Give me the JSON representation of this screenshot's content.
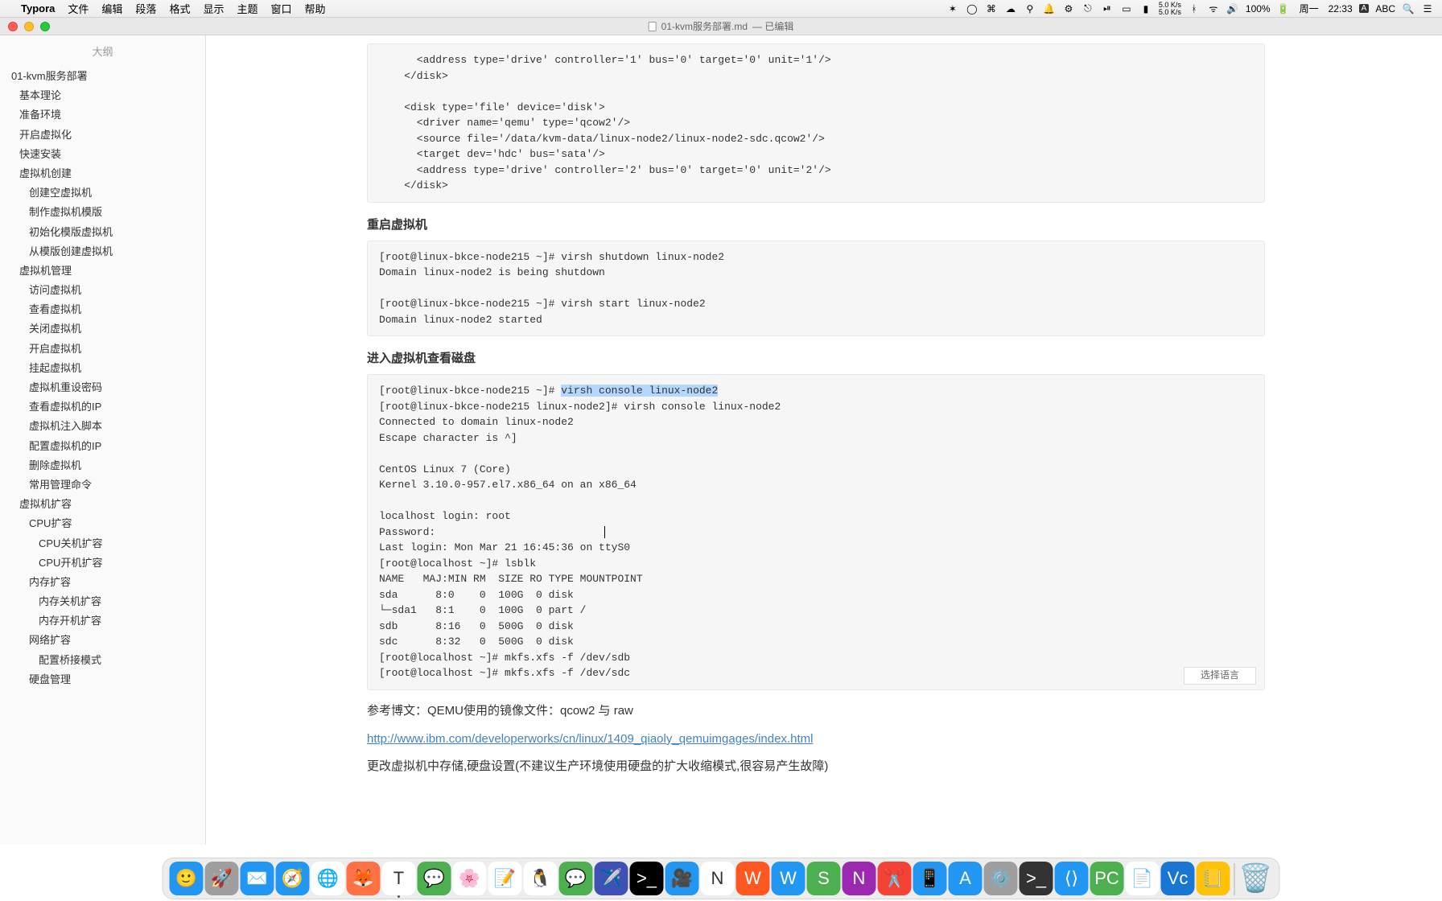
{
  "menubar": {
    "app_name": "Typora",
    "items": [
      "文件",
      "编辑",
      "段落",
      "格式",
      "显示",
      "主题",
      "窗口",
      "帮助"
    ],
    "right": {
      "net_up": "5.0 K/s",
      "net_down": "5.0 K/s",
      "battery": "100%",
      "day": "周一",
      "time": "22:33",
      "input": "ABC"
    }
  },
  "titlebar": {
    "filename": "01-kvm服务部署.md",
    "status": "— 已编辑"
  },
  "sidebar": {
    "title": "大纲",
    "items": [
      {
        "level": 1,
        "label": "01-kvm服务部署"
      },
      {
        "level": 2,
        "label": "基本理论"
      },
      {
        "level": 2,
        "label": "准备环境"
      },
      {
        "level": 2,
        "label": "开启虚拟化"
      },
      {
        "level": 2,
        "label": "快速安装"
      },
      {
        "level": 2,
        "label": "虚拟机创建"
      },
      {
        "level": 3,
        "label": "创建空虚拟机"
      },
      {
        "level": 3,
        "label": "制作虚拟机模版"
      },
      {
        "level": 3,
        "label": "初始化模版虚拟机"
      },
      {
        "level": 3,
        "label": "从模版创建虚拟机"
      },
      {
        "level": 2,
        "label": "虚拟机管理"
      },
      {
        "level": 3,
        "label": "访问虚拟机"
      },
      {
        "level": 3,
        "label": "查看虚拟机"
      },
      {
        "level": 3,
        "label": "关闭虚拟机"
      },
      {
        "level": 3,
        "label": "开启虚拟机"
      },
      {
        "level": 3,
        "label": "挂起虚拟机"
      },
      {
        "level": 3,
        "label": "虚拟机重设密码"
      },
      {
        "level": 3,
        "label": "查看虚拟机的IP"
      },
      {
        "level": 3,
        "label": "虚拟机注入脚本"
      },
      {
        "level": 3,
        "label": "配置虚拟机的IP"
      },
      {
        "level": 3,
        "label": "删除虚拟机"
      },
      {
        "level": 3,
        "label": "常用管理命令"
      },
      {
        "level": 2,
        "label": "虚拟机扩容"
      },
      {
        "level": 3,
        "label": "CPU扩容"
      },
      {
        "level": 4,
        "label": "CPU关机扩容"
      },
      {
        "level": 4,
        "label": "CPU开机扩容"
      },
      {
        "level": 3,
        "label": "内存扩容"
      },
      {
        "level": 4,
        "label": "内存关机扩容"
      },
      {
        "level": 4,
        "label": "内存开机扩容"
      },
      {
        "level": 3,
        "label": "网络扩容"
      },
      {
        "level": 4,
        "label": "配置桥接模式"
      },
      {
        "level": 3,
        "label": "硬盘管理"
      }
    ]
  },
  "content": {
    "code1": "      <address type='drive' controller='1' bus='0' target='0' unit='1'/>\n    </disk>\n\n    <disk type='file' device='disk'>\n      <driver name='qemu' type='qcow2'/>\n      <source file='/data/kvm-data/linux-node2/linux-node2-sdc.qcow2'/>\n      <target dev='hdc' bus='sata'/>\n      <address type='drive' controller='2' bus='0' target='0' unit='2'/>\n    </disk>",
    "h1": "重启虚拟机",
    "code2": "[root@linux-bkce-node215 ~]# virsh shutdown linux-node2\nDomain linux-node2 is being shutdown\n\n[root@linux-bkce-node215 ~]# virsh start linux-node2\nDomain linux-node2 started",
    "h2": "进入虚拟机查看磁盘",
    "code3_pre": "[root@linux-bkce-node215 ~]# ",
    "code3_hl": "virsh console linux-node2",
    "code3_post": "\n[root@linux-bkce-node215 linux-node2]# virsh console linux-node2\nConnected to domain linux-node2\nEscape character is ^]\n\nCentOS Linux 7 (Core)\nKernel 3.10.0-957.el7.x86_64 on an x86_64\n\nlocalhost login: root\nPassword:\nLast login: Mon Mar 21 16:45:36 on ttyS0\n[root@localhost ~]# lsblk\nNAME   MAJ:MIN RM  SIZE RO TYPE MOUNTPOINT\nsda      8:0    0  100G  0 disk\n└─sda1   8:1    0  100G  0 part /\nsdb      8:16   0  500G  0 disk\nsdc      8:32   0  500G  0 disk\n[root@localhost ~]# mkfs.xfs -f /dev/sdb\n[root@localhost ~]# mkfs.xfs -f /dev/sdc",
    "code3_lang": "选择语言",
    "ref_label": "参考博文：QEMU使用的镜像文件：qcow2 与 raw",
    "ref_link": "http://www.ibm.com/developerworks/cn/linux/1409_qiaoly_qemuimgages/index.html",
    "note": "更改虚拟机中存储,硬盘设置(不建议生产环境使用硬盘的扩大收缩模式,很容易产生故障)"
  },
  "dock": {
    "apps": [
      {
        "name": "finder",
        "color": "#2196f3",
        "glyph": "🙂"
      },
      {
        "name": "launchpad",
        "color": "#9e9e9e",
        "glyph": "🚀"
      },
      {
        "name": "mail",
        "color": "#2196f3",
        "glyph": "✉️"
      },
      {
        "name": "safari",
        "color": "#2196f3",
        "glyph": "🧭"
      },
      {
        "name": "chrome",
        "color": "#fff",
        "glyph": "🌐"
      },
      {
        "name": "firefox",
        "color": "#ff7043",
        "glyph": "🦊"
      },
      {
        "name": "typora",
        "color": "#fff",
        "glyph": "T",
        "active": true
      },
      {
        "name": "wechat",
        "color": "#4caf50",
        "glyph": "💬"
      },
      {
        "name": "photos",
        "color": "#fff",
        "glyph": "🌸"
      },
      {
        "name": "reminders",
        "color": "#fff",
        "glyph": "📝"
      },
      {
        "name": "qq",
        "color": "#fff",
        "glyph": "🐧"
      },
      {
        "name": "wechat2",
        "color": "#4caf50",
        "glyph": "💬"
      },
      {
        "name": "feishu",
        "color": "#3f51b5",
        "glyph": "✈️"
      },
      {
        "name": "terminal",
        "color": "#000",
        "glyph": ">_"
      },
      {
        "name": "zoom",
        "color": "#2196f3",
        "glyph": "🎥"
      },
      {
        "name": "notion",
        "color": "#fff",
        "glyph": "N"
      },
      {
        "name": "wps",
        "color": "#ff5722",
        "glyph": "W"
      },
      {
        "name": "wps2",
        "color": "#2196f3",
        "glyph": "W"
      },
      {
        "name": "wps3",
        "color": "#4caf50",
        "glyph": "S"
      },
      {
        "name": "onenote",
        "color": "#9c27b0",
        "glyph": "N"
      },
      {
        "name": "snipaste",
        "color": "#f44336",
        "glyph": "✂️"
      },
      {
        "name": "tencent",
        "color": "#2196f3",
        "glyph": "📱"
      },
      {
        "name": "appstore",
        "color": "#2196f3",
        "glyph": "A"
      },
      {
        "name": "systempref",
        "color": "#9e9e9e",
        "glyph": "⚙️"
      },
      {
        "name": "iterm",
        "color": "#333",
        "glyph": ">_"
      },
      {
        "name": "vscode",
        "color": "#2196f3",
        "glyph": "⟨⟩"
      },
      {
        "name": "pycharm",
        "color": "#4caf50",
        "glyph": "PC"
      },
      {
        "name": "textedit",
        "color": "#fff",
        "glyph": "📄"
      },
      {
        "name": "vnc",
        "color": "#1976d2",
        "glyph": "Vc"
      },
      {
        "name": "notes",
        "color": "#ffc107",
        "glyph": "📒"
      }
    ],
    "trash": {
      "glyph": "🗑️"
    }
  }
}
